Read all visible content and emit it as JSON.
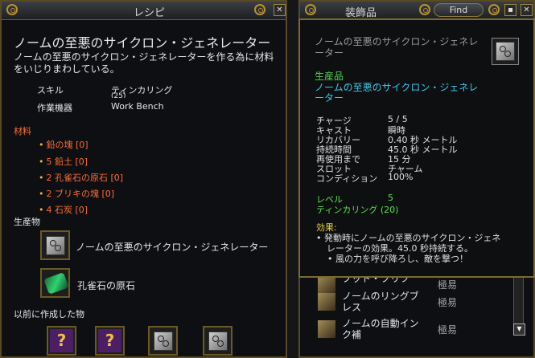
{
  "recipe_window": {
    "title": "レシピ",
    "item_name": "ノームの至悪のサイクロン・ジェネレーター",
    "description": "ノームの至悪のサイクロン・ジェネレーターを作る為に材料をいじりまわしている。",
    "skill_label": "スキル",
    "skill_value": "ティンカリング",
    "skill_level_partial": "(25)",
    "station_label": "作業機器",
    "station_value": "Work Bench",
    "materials_header": "材料",
    "materials": [
      "鉛の塊 [0]",
      "5 鉛土 [0]",
      "2 孔雀石の原石 [0]",
      "2 ブリキの塊 [0]",
      "4 石炭 [0]"
    ],
    "products_header": "生産物",
    "products": [
      {
        "label": "ノームの至悪のサイクロン・ジェネレーター",
        "icon": "cube-icon"
      },
      {
        "label": "孔雀石の原石",
        "icon": "gem-icon"
      }
    ],
    "previous_header": "以前に作成した物"
  },
  "accessory_window": {
    "title": "装飾品",
    "find_label": "Find",
    "list": [
      {
        "name": "ブット・ブリフ",
        "difficulty": "極易"
      },
      {
        "name": "ノームのリングブレス",
        "difficulty": "極易"
      },
      {
        "name": "ノームの自動インク補",
        "difficulty": "極易"
      }
    ]
  },
  "tooltip": {
    "title": "ノームの至悪のサイクロン・ジェネレーター",
    "category": "生産品",
    "item_name": "ノームの至悪のサイクロン・ジェネレーター",
    "stats": [
      {
        "label": "チャージ",
        "value": "5 / 5"
      },
      {
        "label": "キャスト",
        "value": "瞬時"
      },
      {
        "label": "リカバリー",
        "value": "0.40 秒 メートル"
      },
      {
        "label": "持続時間",
        "value": "45.0 秒 メートル"
      },
      {
        "label": "再使用まで",
        "value": "15 分"
      },
      {
        "label": "スロット",
        "value": "チャーム"
      },
      {
        "label": "コンディション",
        "value": "100%"
      }
    ],
    "level_label": "レベル",
    "level_value": "5",
    "req_skill": "ティンカリング (20)",
    "effect_header": "効果:",
    "effect_line1": "• 発動時にノームの至悪のサイクロン・ジェネ",
    "effect_line2": "レーターの効果。45.0 秒持続する。",
    "effect_line3": "• 風の力を呼び降ろし、敵を撃つ！"
  },
  "colors": {
    "gold_border": "#7e6a2c",
    "material_orange": "#ff6d36",
    "category_green": "#52d452",
    "item_cyan": "#3fc8e8",
    "req_green": "#58e04d",
    "effect_yellow": "#e8d44e"
  }
}
